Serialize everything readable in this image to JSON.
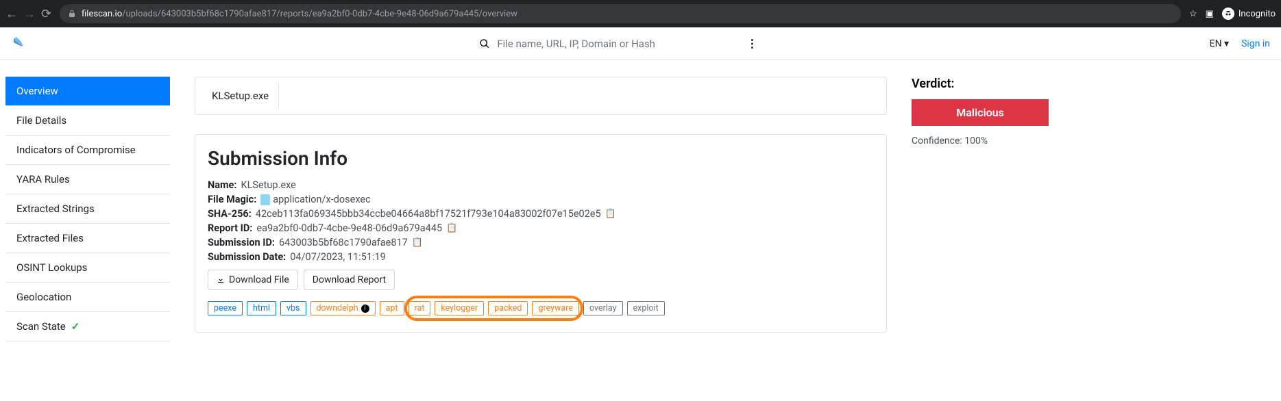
{
  "browser": {
    "url_domain": "filescan.io",
    "url_path": "/uploads/643003b5bf68c1790afae817/reports/ea9a2bf0-0db7-4cbe-9e48-06d9a679a445/overview",
    "incognito_label": "Incognito"
  },
  "header": {
    "search_placeholder": "File name, URL, IP, Domain or Hash",
    "lang": "EN",
    "signin": "Sign in"
  },
  "sidebar": {
    "items": [
      {
        "label": "Overview",
        "active": true
      },
      {
        "label": "File Details"
      },
      {
        "label": "Indicators of Compromise"
      },
      {
        "label": "YARA Rules"
      },
      {
        "label": "Extracted Strings"
      },
      {
        "label": "Extracted Files"
      },
      {
        "label": "OSINT Lookups"
      },
      {
        "label": "Geolocation"
      },
      {
        "label": "Scan State",
        "check": true
      }
    ]
  },
  "file_tab": "KLSetup.exe",
  "submission": {
    "heading": "Submission Info",
    "name_label": "Name:",
    "name_value": "KLSetup.exe",
    "magic_label": "File Magic:",
    "magic_value": "application/x-dosexec",
    "sha_label": "SHA-256:",
    "sha_value": "42ceb113fa069345bbb34ccbe04664a8bf17521f793e104a83002f07e15e02e5",
    "report_label": "Report ID:",
    "report_value": "ea9a2bf0-0db7-4cbe-9e48-06d9a679a445",
    "subid_label": "Submission ID:",
    "subid_value": "643003b5bf68c1790afae817",
    "date_label": "Submission Date:",
    "date_value": "04/07/2023, 11:51:19",
    "download_file": "Download File",
    "download_report": "Download Report"
  },
  "tags": [
    {
      "label": "peexe",
      "color": "blue"
    },
    {
      "label": "html",
      "color": "blue"
    },
    {
      "label": "vbs",
      "color": "blue"
    },
    {
      "label": "downdelph",
      "color": "orange",
      "info": true
    },
    {
      "label": "apt",
      "color": "orange"
    },
    {
      "label": "rat",
      "color": "orange"
    },
    {
      "label": "keylogger",
      "color": "orange"
    },
    {
      "label": "packed",
      "color": "orange"
    },
    {
      "label": "greyware",
      "color": "orange"
    },
    {
      "label": "overlay",
      "color": "grey"
    },
    {
      "label": "exploit",
      "color": "grey"
    }
  ],
  "verdict": {
    "heading": "Verdict:",
    "value": "Malicious",
    "confidence_label": "Confidence:",
    "confidence_value": "100%"
  }
}
